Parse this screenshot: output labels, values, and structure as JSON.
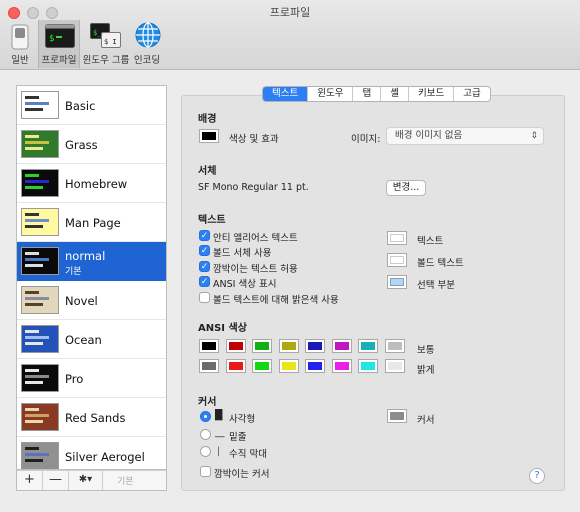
{
  "window": {
    "title": "프로파일"
  },
  "toolbar": {
    "items": [
      {
        "label": "일반",
        "icon": "switch-icon"
      },
      {
        "label": "프로파일",
        "icon": "terminal-profile-icon"
      },
      {
        "label": "윈도우 그룹",
        "icon": "window-groups-icon"
      },
      {
        "label": "인코딩",
        "icon": "globe-icon"
      }
    ],
    "selected": "프로파일"
  },
  "sidebar": {
    "profiles": [
      {
        "name": "Basic",
        "bg": "#ffffff",
        "fg": "#333333",
        "accent": "#5a7fc4"
      },
      {
        "name": "Grass",
        "bg": "#2f7a2b",
        "fg": "#f0e68c",
        "accent": "#c8c040"
      },
      {
        "name": "Homebrew",
        "bg": "#0a0a0a",
        "fg": "#28d228",
        "accent": "#2828d2"
      },
      {
        "name": "Man Page",
        "bg": "#fff9a0",
        "fg": "#333333",
        "accent": "#6f8fd0"
      },
      {
        "name": "normal",
        "sub": "기본",
        "bg": "#0a0a0a",
        "fg": "#dddddd",
        "accent": "#4a78c8"
      },
      {
        "name": "Novel",
        "bg": "#e0d7bd",
        "fg": "#5a3f2a",
        "accent": "#8a8aa0"
      },
      {
        "name": "Ocean",
        "bg": "#2452b8",
        "fg": "#e6e6e6",
        "accent": "#a0c0f0"
      },
      {
        "name": "Pro",
        "bg": "#0a0a0a",
        "fg": "#e6e6e6",
        "accent": "#8a8a8a"
      },
      {
        "name": "Red Sands",
        "bg": "#8a3a24",
        "fg": "#e8d7a8",
        "accent": "#d0a060"
      },
      {
        "name": "Silver Aerogel",
        "bg": "#909090",
        "fg": "#202020",
        "accent": "#6070c0"
      }
    ],
    "selected": "normal",
    "footer": {
      "add": "+",
      "remove": "—",
      "gear": "✱▾",
      "default_label": "기본"
    }
  },
  "tabs": [
    "텍스트",
    "윈도우",
    "탭",
    "셸",
    "키보드",
    "고급"
  ],
  "active_tab": "텍스트",
  "background": {
    "section": "배경",
    "color_effects_label": "색상 및 효과",
    "color": "#000000",
    "image_label": "이미지:",
    "image_value": "배경 이미지 없음"
  },
  "font": {
    "section": "서체",
    "value": "SF Mono Regular 11 pt.",
    "change_button": "변경..."
  },
  "text": {
    "section": "텍스트",
    "options": [
      {
        "label": "안티 앨리어스 텍스트",
        "checked": true
      },
      {
        "label": "볼드 서체 사용",
        "checked": true
      },
      {
        "label": "깜박이는 텍스트 허용",
        "checked": true
      },
      {
        "label": "ANSI 색상 표시",
        "checked": true
      },
      {
        "label": "볼드 텍스트에 대해 밝은색 사용",
        "checked": false
      }
    ],
    "swatches": [
      {
        "label": "텍스트",
        "color": "#ffffff"
      },
      {
        "label": "볼드 텍스트",
        "color": "#ffffff"
      },
      {
        "label": "선택 부분",
        "color": "#b6d3f0"
      }
    ]
  },
  "ansi": {
    "section": "ANSI 색상",
    "normal_label": "보통",
    "bright_label": "밝게",
    "normal": [
      "#000000",
      "#c00000",
      "#12b012",
      "#b0a812",
      "#1a1ab8",
      "#c018c0",
      "#18b0b8",
      "#bdbdbd"
    ],
    "bright": [
      "#6b6b6b",
      "#e81a1a",
      "#12d812",
      "#e6e618",
      "#2222f0",
      "#e820e8",
      "#20e6e6",
      "#e8e8e8"
    ]
  },
  "cursor": {
    "section": "커서",
    "options": [
      {
        "glyph": "█",
        "label": "사각형",
        "selected": true
      },
      {
        "glyph": "__",
        "label": "밑줄",
        "selected": false
      },
      {
        "glyph": "|",
        "label": "수직 막대",
        "selected": false
      }
    ],
    "blink_label": "깜박이는 커서",
    "blink_checked": false,
    "color_label": "커서",
    "color": "#8c8c8c"
  },
  "help": "?"
}
